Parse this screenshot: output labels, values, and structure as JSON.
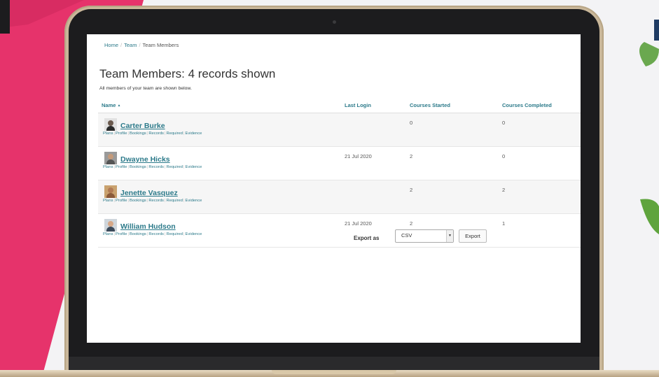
{
  "breadcrumb": {
    "home": "Home",
    "team": "Team",
    "current": "Team Members",
    "separator": "/"
  },
  "page": {
    "title": "Team Members: 4 records shown",
    "subtitle": "All members of your team are shown below."
  },
  "table": {
    "columns": {
      "name": "Name",
      "sort_indicator": "▲",
      "last_login": "Last Login",
      "courses_started": "Courses Started",
      "courses_completed": "Courses Completed"
    },
    "links": [
      "Plans",
      "Profile",
      "Bookings",
      "Records",
      "Required",
      "Evidence"
    ],
    "rows": [
      {
        "name": "Carter Burke",
        "last_login": "",
        "started": "0",
        "completed": "0"
      },
      {
        "name": "Dwayne Hicks",
        "last_login": "21 Jul 2020",
        "started": "2",
        "completed": "0"
      },
      {
        "name": "Jenette Vasquez",
        "last_login": "",
        "started": "2",
        "completed": "2"
      },
      {
        "name": "William Hudson",
        "last_login": "21 Jul 2020",
        "started": "2",
        "completed": "1"
      }
    ]
  },
  "export": {
    "label": "Export as",
    "selected": "CSV",
    "button": "Export"
  },
  "colors": {
    "accent": "#2c7a8a",
    "pink": "#e6336b",
    "green": "#6aa84f"
  }
}
